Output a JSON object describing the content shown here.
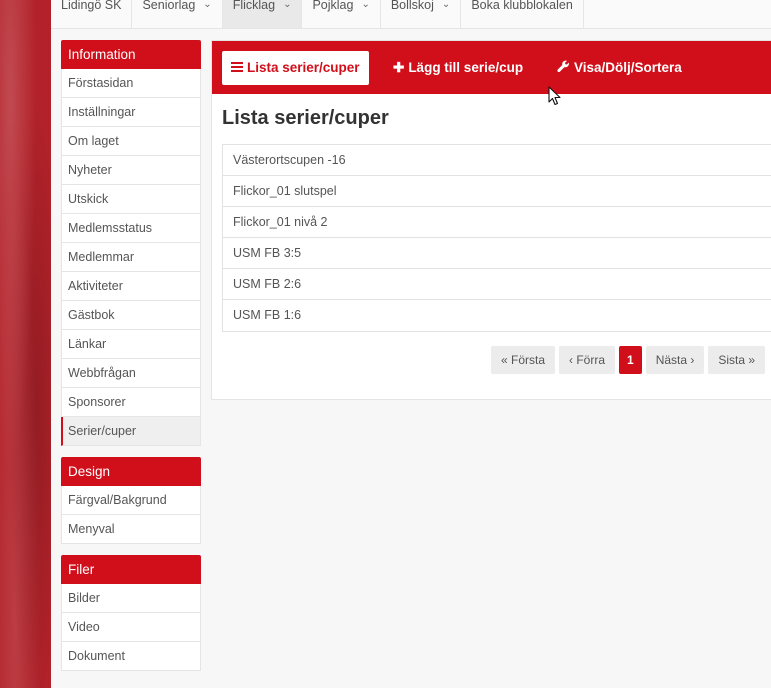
{
  "topnav": [
    {
      "label": "Lidingö SK",
      "dropdown": false,
      "active": false
    },
    {
      "label": "Seniorlag",
      "dropdown": true,
      "active": false
    },
    {
      "label": "Flicklag",
      "dropdown": true,
      "active": true
    },
    {
      "label": "Pojklag",
      "dropdown": true,
      "active": false
    },
    {
      "label": "Bollskoj",
      "dropdown": true,
      "active": false
    },
    {
      "label": "Boka klubblokalen",
      "dropdown": false,
      "active": false
    }
  ],
  "sidebar": {
    "information": {
      "title": "Information",
      "items": [
        "Förstasidan",
        "Inställningar",
        "Om laget",
        "Nyheter",
        "Utskick",
        "Medlemsstatus",
        "Medlemmar",
        "Aktiviteter",
        "Gästbok",
        "Länkar",
        "Webbfrågan",
        "Sponsorer",
        "Serier/cuper"
      ],
      "active": "Serier/cuper"
    },
    "design": {
      "title": "Design",
      "items": [
        "Färgval/Bakgrund",
        "Menyval"
      ]
    },
    "filer": {
      "title": "Filer",
      "items": [
        "Bilder",
        "Video",
        "Dokument"
      ]
    }
  },
  "toolbar": {
    "list_label": "Lista serier/cuper",
    "add_label": "Lägg till serie/cup",
    "visa_label": "Visa/Dölj/Sortera"
  },
  "main": {
    "heading": "Lista serier/cuper",
    "rows": [
      "Västerortscupen -16",
      "Flickor_01 slutspel",
      "Flickor_01 nivå 2",
      "USM FB 3:5",
      "USM FB 2:6",
      "USM FB 1:6"
    ]
  },
  "pagination": {
    "first": "« Första",
    "prev": "‹ Förra",
    "current": "1",
    "next": "Nästa ›",
    "last": "Sista »"
  },
  "colors": {
    "accent": "#d10f1b",
    "background": "#f7f7f7"
  },
  "icons": {
    "menu": "bars-icon",
    "add": "plus-icon",
    "settings": "wrench-icon",
    "dropdown": "chevron-down-icon"
  }
}
